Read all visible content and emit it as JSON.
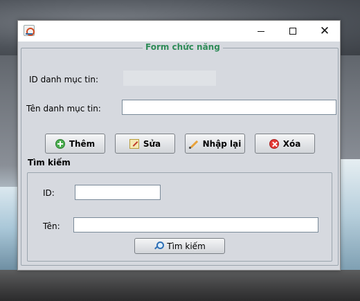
{
  "form": {
    "title": "Form chức năng",
    "id_label": "ID danh mục tin:",
    "id_value": "",
    "name_label": "Tên danh mục tin:",
    "name_value": ""
  },
  "buttons": {
    "add": "Thêm",
    "edit": "Sửa",
    "reset": "Nhập lại",
    "delete": "Xóa"
  },
  "search": {
    "title": "Tìm kiếm",
    "id_label": "ID:",
    "id_value": "",
    "name_label": "Tên:",
    "name_value": "",
    "button": "Tìm kiếm"
  },
  "colors": {
    "legend": "#2e8b57",
    "panel_bg": "#d6d9df"
  }
}
